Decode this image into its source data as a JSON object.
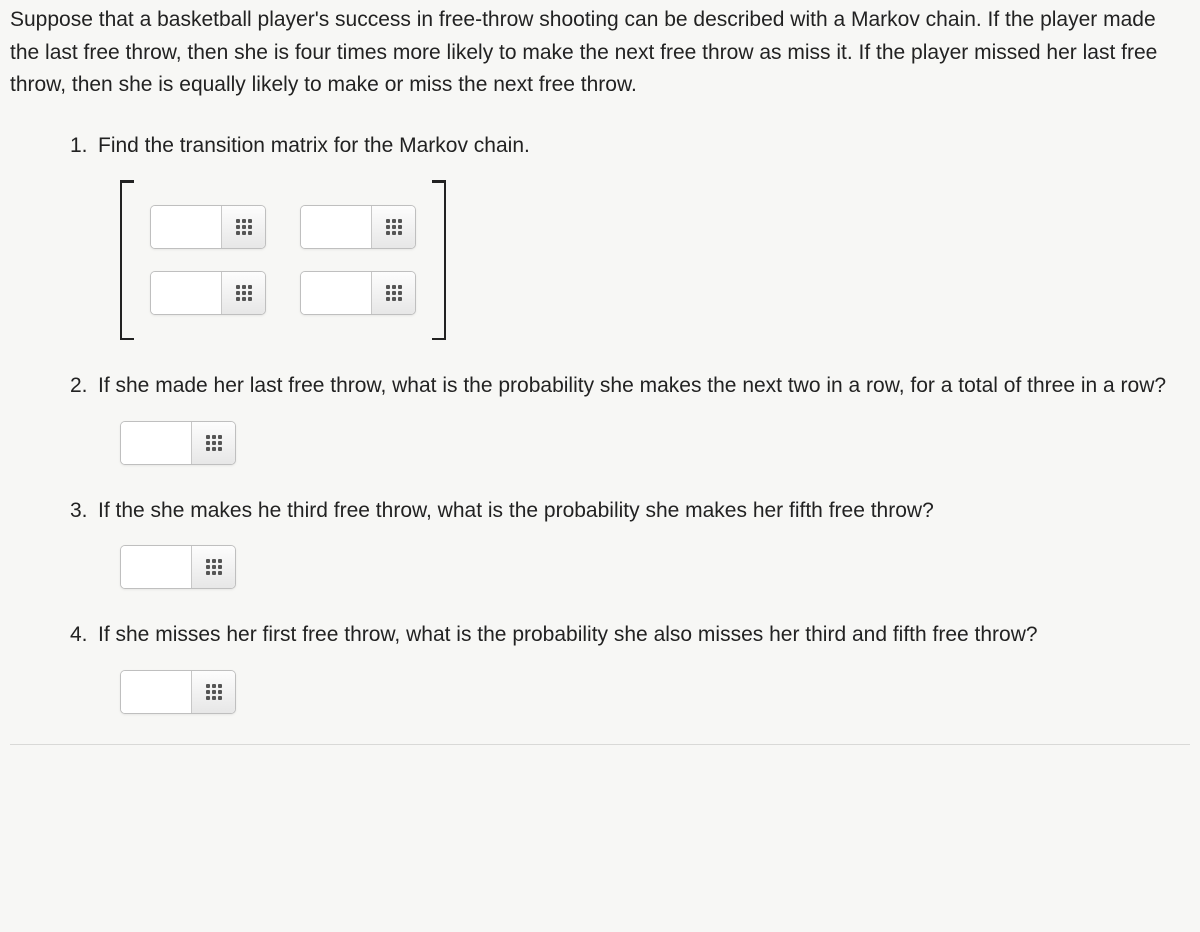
{
  "intro": "Suppose that a basketball player's success in free-throw shooting can be described with a Markov chain. If the player made the last free throw, then she is four times more likely to make the next free throw as miss it. If the player missed her last free throw, then she is equally likely to make or miss the next free throw.",
  "questions": [
    {
      "number": "1.",
      "text": "Find the transition matrix for the Markov chain.",
      "type": "matrix"
    },
    {
      "number": "2.",
      "text": "If she made her last free throw, what is the probability she makes the next two in a row, for a total of three in a row?",
      "type": "single"
    },
    {
      "number": "3.",
      "text": "If the she makes he third free throw, what is the probability she makes her fifth free throw?",
      "type": "single"
    },
    {
      "number": "4.",
      "text": "If she misses her first free throw, what is the probability she also misses her third and fifth free throw?",
      "type": "single"
    }
  ]
}
